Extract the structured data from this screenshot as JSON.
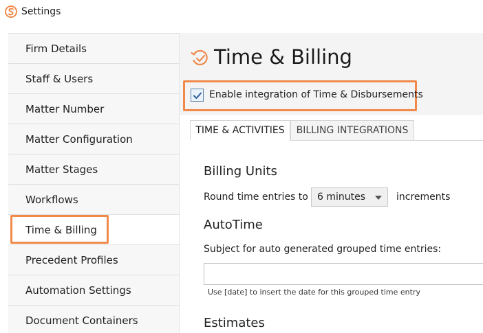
{
  "window": {
    "title": "Settings",
    "app_icon": "s-logo-icon",
    "accent_color": "#f08a4b"
  },
  "sidebar": {
    "items": [
      {
        "label": "Firm Details"
      },
      {
        "label": "Staff & Users"
      },
      {
        "label": "Matter Number"
      },
      {
        "label": "Matter Configuration"
      },
      {
        "label": "Matter Stages"
      },
      {
        "label": "Workflows"
      },
      {
        "label": "Time & Billing",
        "selected": true
      },
      {
        "label": "Precedent Profiles"
      },
      {
        "label": "Automation Settings"
      },
      {
        "label": "Document Containers"
      }
    ]
  },
  "page": {
    "title": "Time & Billing",
    "title_icon": "time-check-icon",
    "enable_integration": {
      "label": "Enable integration of Time & Disbursements",
      "checked": true
    },
    "tabs": [
      {
        "label": "TIME & ACTIVITIES",
        "active": true
      },
      {
        "label": "BILLING INTEGRATIONS",
        "active": false
      }
    ],
    "billing_units": {
      "heading": "Billing Units",
      "prefix_label": "Round time entries to",
      "selected_value": "6 minutes",
      "suffix_label": "increments"
    },
    "autotime": {
      "heading": "AutoTime",
      "subject_label": "Subject for auto generated grouped time entries:",
      "subject_value": "",
      "hint": "Use [date] to insert the date for this grouped time entry"
    },
    "estimates": {
      "heading": "Estimates"
    }
  }
}
